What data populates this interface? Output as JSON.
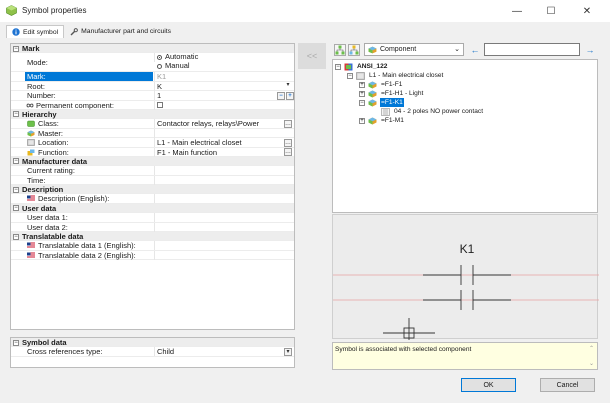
{
  "window": {
    "title": "Symbol properties",
    "minimize": "—",
    "maximize": "☐",
    "close": "✕"
  },
  "tabs": [
    {
      "label": "Edit symbol",
      "active": true
    },
    {
      "label": "Manufacturer part and circuits",
      "active": false
    }
  ],
  "props": {
    "mark": {
      "header": "Mark",
      "mode_label": "Mode:",
      "mode_options": [
        "Automatic",
        "Manual"
      ],
      "mode_selected": "Automatic",
      "mark_label": "Mark:",
      "mark_value": "K1",
      "root_label": "Root:",
      "root_value": "K",
      "number_label": "Number:",
      "number_value": "1",
      "permanent_label": "Permanent component:",
      "permanent_checked": false
    },
    "hierarchy": {
      "header": "Hierarchy",
      "class_label": "Class:",
      "class_value": "Contactor relays, relays\\Power",
      "master_label": "Master:",
      "master_value": "",
      "location_label": "Location:",
      "location_value": "L1 - Main electrical closet",
      "function_label": "Function:",
      "function_value": "F1 - Main function"
    },
    "manufacturer": {
      "header": "Manufacturer data",
      "rating_label": "Current rating:",
      "time_label": "Time:"
    },
    "description": {
      "header": "Description",
      "english_label": "Description (English):"
    },
    "user": {
      "header": "User data",
      "data1_label": "User data 1:",
      "data2_label": "User data 2:"
    },
    "translatable": {
      "header": "Translatable data",
      "data1_label": "Translatable data 1 (English):",
      "data2_label": "Translatable data 2 (English):"
    },
    "symbol": {
      "header": "Symbol data",
      "xref_label": "Cross references type:",
      "xref_value": "Child"
    }
  },
  "transfer_button": "<<",
  "toolbar": {
    "combo_value": "Component",
    "search_value": ""
  },
  "tree": {
    "nodes": [
      {
        "label": "ANSI_122",
        "level": 0,
        "bold": true,
        "expander": "−"
      },
      {
        "label": "L1 - Main electrical closet",
        "level": 1,
        "expander": "−"
      },
      {
        "label": "=F1-F1",
        "level": 2,
        "expander": "+"
      },
      {
        "label": "=F1-H1 - Light",
        "level": 2,
        "expander": "+"
      },
      {
        "label": "=F1-K1",
        "level": 2,
        "expander": "−",
        "selected": true
      },
      {
        "label": "04 - 2 poles NO power contact",
        "level": 3,
        "expander": ""
      },
      {
        "label": "=F1-M1",
        "level": 2,
        "expander": "+"
      }
    ]
  },
  "preview": {
    "tag": "K1"
  },
  "message": "Symbol is associated with selected component",
  "buttons": {
    "ok": "OK",
    "cancel": "Cancel"
  },
  "colors": {
    "accent": "#0078d7",
    "selection_text": "#ffffff",
    "message_bg": "#ffffe1",
    "preview_bg": "#ececec",
    "wire_red": "#e8a0a0"
  }
}
